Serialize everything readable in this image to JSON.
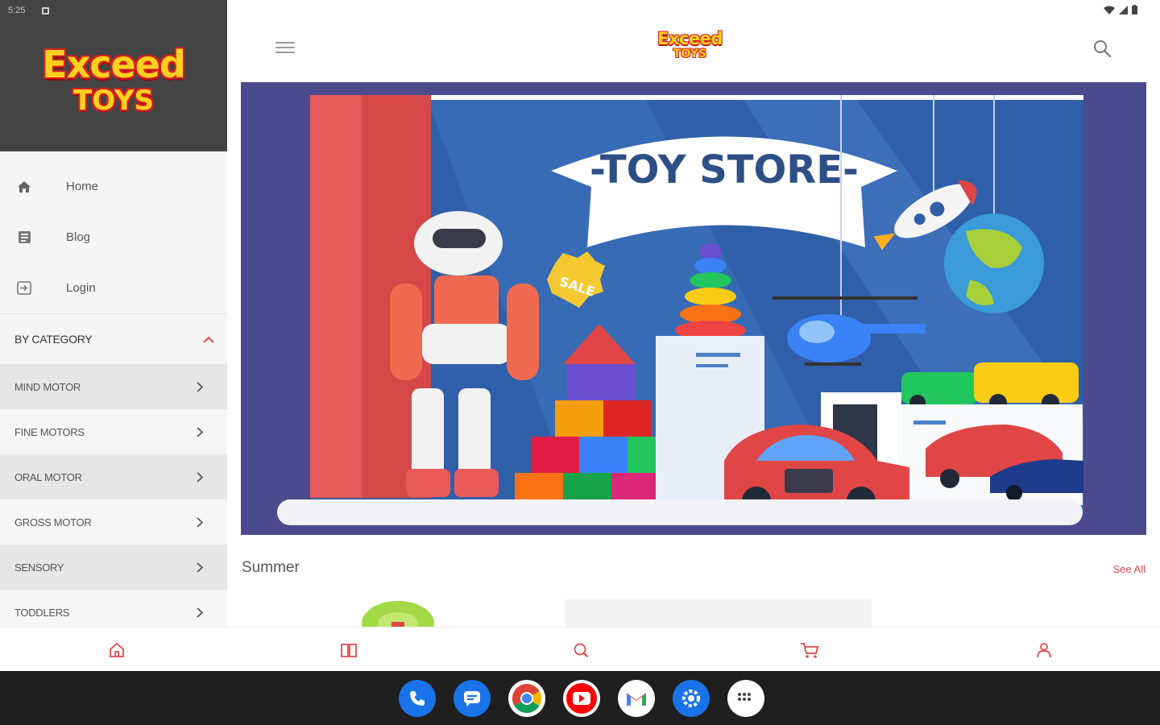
{
  "status_bar": {
    "time": "5:25"
  },
  "brand": {
    "line1": "Exceed",
    "line2": "TOYS"
  },
  "drawer": {
    "menu": [
      {
        "label": "Home",
        "icon": "home-icon"
      },
      {
        "label": "Blog",
        "icon": "blog-icon"
      },
      {
        "label": "Login",
        "icon": "login-icon"
      }
    ],
    "category_header": "BY CATEGORY",
    "categories": [
      {
        "label": "MIND MOTOR"
      },
      {
        "label": "FINE MOTORS"
      },
      {
        "label": "ORAL MOTOR"
      },
      {
        "label": "GROSS MOTOR"
      },
      {
        "label": "SENSORY"
      },
      {
        "label": "TODDLERS"
      }
    ]
  },
  "banner": {
    "headline": "-TOY STORE-",
    "sale_tag": "SALE"
  },
  "section": {
    "title": "Summer",
    "see_all": "See All"
  },
  "bottom_nav": [
    "home-icon",
    "blog-icon",
    "search-icon",
    "cart-icon",
    "account-icon"
  ],
  "dock": [
    "phone-icon",
    "messages-icon",
    "chrome-icon",
    "youtube-icon",
    "gmail-icon",
    "settings-icon",
    "app-drawer-icon"
  ],
  "colors": {
    "accent": "#e5484d",
    "drawer_header": "#444444",
    "banner_bg": "#4a4a8c",
    "taskbar": "#1f1f1f"
  }
}
